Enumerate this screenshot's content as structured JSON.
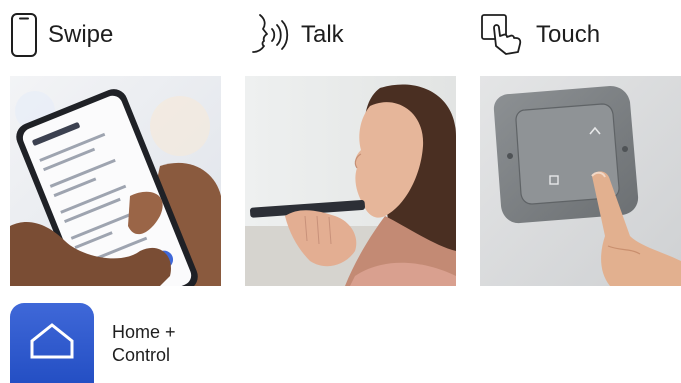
{
  "sections": [
    {
      "label": "Swipe",
      "icon": "smartphone-icon",
      "photo": "hands-holding-smartphone-photo"
    },
    {
      "label": "Talk",
      "icon": "speaking-face-icon",
      "photo": "woman-talking-to-phone-photo"
    },
    {
      "label": "Touch",
      "icon": "finger-tap-switch-icon",
      "photo": "finger-pressing-wall-switch-photo"
    }
  ],
  "app": {
    "name_line1": "Home +",
    "name_line2": "Control",
    "icon": "home-app-icon",
    "color": "#2f5bd0"
  }
}
